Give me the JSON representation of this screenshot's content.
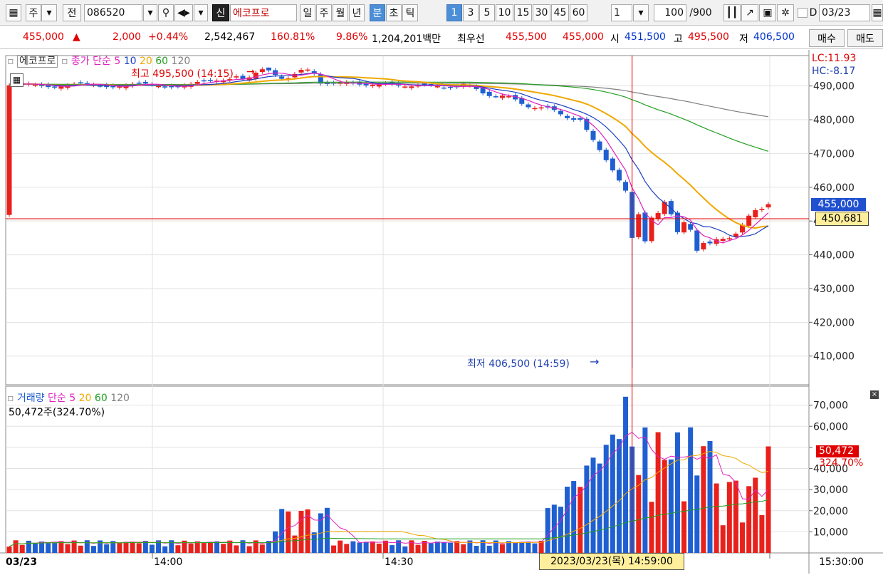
{
  "toolbar": {
    "type_select": "주",
    "mode_label": "전",
    "code": "086520",
    "new_badge": "신",
    "stock_name": "에코프로",
    "period_tabs": [
      "일",
      "주",
      "월",
      "년",
      "분",
      "초",
      "틱"
    ],
    "active_period": "분",
    "interval_tabs": [
      "1",
      "3",
      "5",
      "10",
      "15",
      "30",
      "45",
      "60"
    ],
    "active_interval": "1",
    "multiplier": "1",
    "count_value": "100",
    "count_total": "/900",
    "date_value": "03/23",
    "d_label": "D"
  },
  "quote": {
    "price": "455,000",
    "arrow": "▲",
    "change": "2,000",
    "change_pct": "+0.44%",
    "volume": "2,542,467",
    "vol_ratio": "160.81%",
    "turnover": "9.86%",
    "amount": "1,204,201백만",
    "best_label": "최우선",
    "best_ask": "455,500",
    "best_bid": "455,000",
    "open_label": "시",
    "open": "451,500",
    "high_label": "고",
    "high": "495,500",
    "low_label": "저",
    "low": "406,500",
    "buy_button": "매수",
    "sell_button": "매도"
  },
  "price_panel": {
    "legend_name": "에코프로",
    "legend_type": "종가 단순",
    "ma_periods": [
      "5",
      "10",
      "20",
      "60",
      "120"
    ],
    "high_annotation": "최고 495,500 (14:15)",
    "low_annotation": "최저 406,500 (14:59)",
    "lc_label": "LC:11.93",
    "hc_label": "HC:-8.17",
    "current_price_tag": "455,000",
    "crosshair_price_tag": "450,681"
  },
  "volume_panel": {
    "legend_name": "거래량",
    "legend_type": "단순",
    "ma_periods": [
      "5",
      "20",
      "60",
      "120"
    ],
    "info": "50,472주(324.70%)",
    "current_tag": "50,472",
    "current_pct_tag": "324.70%"
  },
  "time_axis": {
    "date_label": "03/23",
    "ticks": [
      "14:00",
      "14:30",
      "15:30:00"
    ],
    "crosshair_time": "2023/03/23(목) 14:59:00"
  },
  "colors": {
    "up": "#e8211c",
    "down": "#1f5fd1",
    "ma5": "#e020c0",
    "ma10": "#1a3fc0",
    "ma20": "#f0a800",
    "ma60": "#20a020",
    "ma120": "#808080"
  },
  "chart_data": [
    {
      "type": "candlestick",
      "title": "에코프로",
      "y_ticks": [
        410000,
        420000,
        430000,
        440000,
        450000,
        460000,
        470000,
        480000,
        490000
      ],
      "y_tick_labels": [
        "410,000",
        "420,000",
        "430,000",
        "440,000",
        "450,000",
        "460,000",
        "470,000",
        "480,000",
        "490,000"
      ],
      "ylim": [
        401500,
        499000
      ],
      "open": 451500,
      "high": 495500,
      "low": 406500,
      "close": 455000
    },
    {
      "type": "bar",
      "title": "거래량",
      "y_ticks": [
        10000,
        20000,
        30000,
        40000,
        50000,
        60000,
        70000
      ],
      "y_tick_labels": [
        "10,000",
        "20,000",
        "30,000",
        "40,000",
        "",
        "60,000",
        "70,000"
      ],
      "ylim": [
        0,
        79000
      ],
      "last_value": 50472,
      "max_value": 74000
    }
  ]
}
